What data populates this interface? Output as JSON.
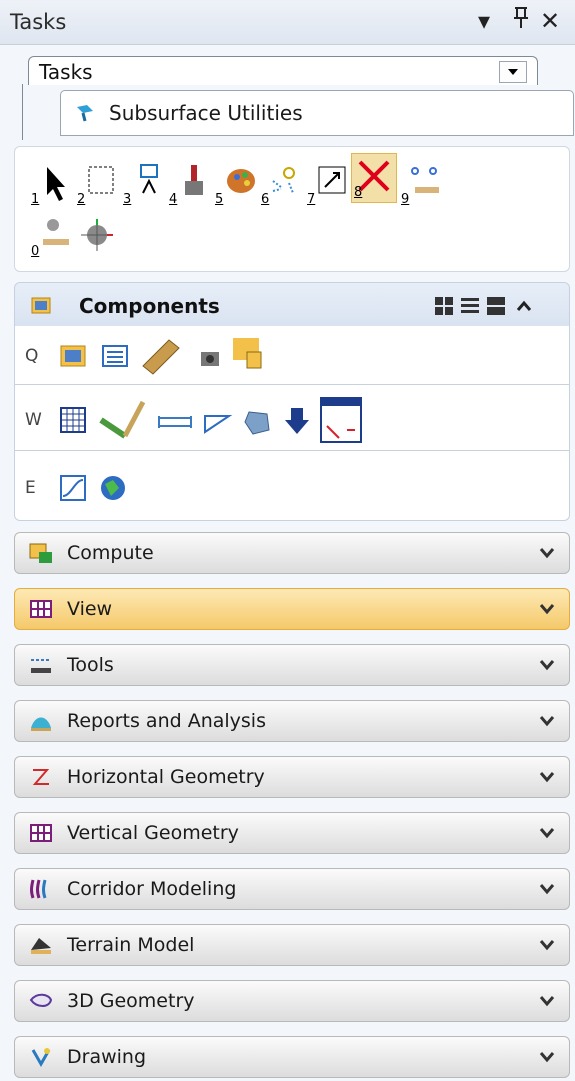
{
  "window": {
    "title": "Tasks",
    "dropdown_glyph": "▾",
    "pin_glyph": "Ꝑ",
    "close_glyph": "✕"
  },
  "tasks_selector": {
    "value": "Tasks"
  },
  "task_tab": {
    "label": "Subsurface Utilities",
    "icon": "subsurface-icon"
  },
  "tools": [
    {
      "num": "1",
      "icon": "select-arrow-icon"
    },
    {
      "num": "2",
      "icon": "selection-box-icon"
    },
    {
      "num": "3",
      "icon": "move-element-icon"
    },
    {
      "num": "4",
      "icon": "paint-brush-icon"
    },
    {
      "num": "5",
      "icon": "palette-icon"
    },
    {
      "num": "6",
      "icon": "highlight-spark-icon"
    },
    {
      "num": "7",
      "icon": "scale-box-icon"
    },
    {
      "num": "8",
      "icon": "delete-x-icon"
    },
    {
      "num": "9",
      "icon": "measure-distance-icon"
    },
    {
      "num": "0",
      "icon": "measure-point-icon"
    },
    {
      "num": "",
      "icon": "target-snap-icon"
    }
  ],
  "components": {
    "title": "Components",
    "rows": [
      {
        "key": "Q",
        "icons": [
          "components-folder-icon",
          "properties-list-icon",
          "ruler-pencil-icon",
          "camera-render-icon",
          "folder-lock-icon"
        ]
      },
      {
        "key": "W",
        "icons": [
          "grid-table-icon",
          "hammer-icon",
          "pipe-icon",
          "slope-line-icon",
          "shape-blob-icon",
          "arrow-down-icon",
          "spreadsheet-icon"
        ]
      },
      {
        "key": "E",
        "icons": [
          "profile-curve-icon",
          "globe-icon"
        ]
      }
    ]
  },
  "sections": [
    {
      "label": "Compute",
      "icon": "compute-icon"
    },
    {
      "label": "View",
      "icon": "view-grid-icon",
      "highlight": true
    },
    {
      "label": "Tools",
      "icon": "tools-icon"
    },
    {
      "label": "Reports and Analysis",
      "icon": "reports-icon"
    },
    {
      "label": "Horizontal Geometry",
      "icon": "horizontal-geometry-icon"
    },
    {
      "label": "Vertical Geometry",
      "icon": "vertical-geometry-icon"
    },
    {
      "label": "Corridor Modeling",
      "icon": "corridor-icon"
    },
    {
      "label": "Terrain Model",
      "icon": "terrain-icon"
    },
    {
      "label": "3D Geometry",
      "icon": "geometry-3d-icon"
    },
    {
      "label": "Drawing",
      "icon": "drawing-icon"
    }
  ]
}
